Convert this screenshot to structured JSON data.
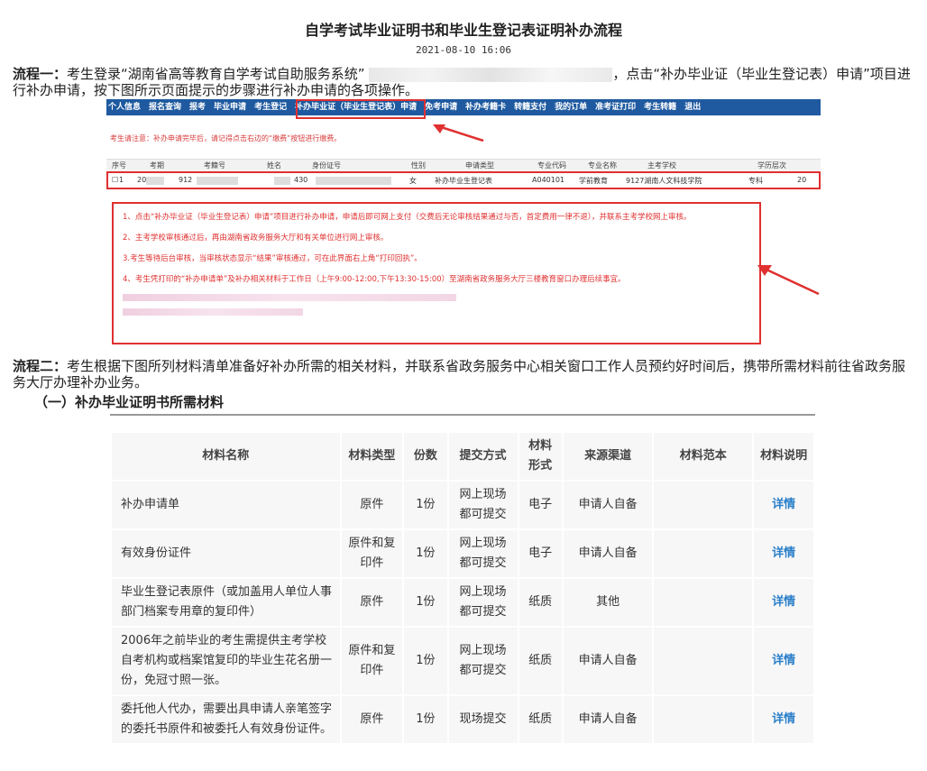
{
  "doc": {
    "title": "自学考试毕业证明书和毕业生登记表证明补办流程",
    "date": "2021-08-10 16:06"
  },
  "process1": {
    "label": "流程一：",
    "text_a": "考生登录“湖南省高等教育自学考试自助服务系统”",
    "text_b": "，点击“补办毕业证（毕业生登记表）申请”项目进行补办申请，按下图所示页面提示的步骤进行补办申请的各项操作。"
  },
  "screenshot": {
    "nav": [
      "个人信息",
      "报名查询",
      "报考",
      "毕业申请",
      "考生登记",
      "补办毕业证（毕业生登记表）申请",
      "免考申请",
      "补办考籍卡",
      "转籍支付",
      "我的订单",
      "准考证打印",
      "考生转籍",
      "退出"
    ],
    "notice": "考生请注意：补办申请完毕后，请记得点击右边的“缴费”按钮进行缴费。",
    "headers": [
      "序号",
      "考期",
      "考籍号",
      "姓名",
      "身份证号",
      "性别",
      "申请类型",
      "专业代码",
      "专业名称",
      "主考学校",
      "学历层次"
    ],
    "row": [
      "1",
      "20",
      "912",
      "",
      "430",
      "女",
      "补办毕业生登记表",
      "A040101",
      "学前教育",
      "9127湖南人文科技学院",
      "专科",
      "20"
    ],
    "instructions": [
      "1、点击“补办毕业证（毕业生登记表）申请”项目进行补办申请，申请后即可网上支付（交费后无论审核结果通过与否，首定费用一律不退），并联系主考学校网上审核。",
      "2、主考学校审核通过后，再由湖南省政务服务大厅和有关单位进行网上审核。",
      "3.考生等待后台审核，当审核状态显示“结果”审核通过，可在此界面右上角“打印回执”。",
      "4、考生凭打印的“补办申请单”及补办相关材料于工作日（上午9:00-12:00,下午13:30-15:00）至湖南省政务服务大厅三楼教育窗口办理后续事宜。"
    ]
  },
  "process2": {
    "label": "流程二：",
    "text": "考生根据下图所列材料清单准备好补办所需的相关材料，并联系省政务服务中心相关窗口工作人员预约好时间后，携带所需材料前往省政务服务大厅办理补办业务。"
  },
  "section1": {
    "title": "（一）补办毕业证明书所需材料"
  },
  "materials": {
    "headers": [
      "材料名称",
      "材料类型",
      "份数",
      "提交方式",
      "材料形式",
      "来源渠道",
      "材料范本",
      "材料说明"
    ],
    "rows": [
      {
        "name": "补办申请单",
        "type": "原件",
        "count": "1份",
        "submit": "网上现场都可提交",
        "form": "电子",
        "source": "申请人自备",
        "sample": "",
        "detail": "详情"
      },
      {
        "name": "有效身份证件",
        "type": "原件和复印件",
        "count": "1份",
        "submit": "网上现场都可提交",
        "form": "电子",
        "source": "申请人自备",
        "sample": "",
        "detail": "详情"
      },
      {
        "name": "毕业生登记表原件（或加盖用人单位人事部门档案专用章的复印件）",
        "type": "原件",
        "count": "1份",
        "submit": "网上现场都可提交",
        "form": "纸质",
        "source": "其他",
        "sample": "",
        "detail": "详情"
      },
      {
        "name": "2006年之前毕业的考生需提供主考学校自考机构或档案馆复印的毕业生花名册一份，免冠寸照一张。",
        "type": "原件和复印件",
        "count": "1份",
        "submit": "网上现场都可提交",
        "form": "纸质",
        "source": "申请人自备",
        "sample": "",
        "detail": "详情"
      },
      {
        "name": "委托他人代办，需要出具申请人亲笔签字的委托书原件和被委托人有效身份证件。",
        "type": "原件",
        "count": "1份",
        "submit": "现场提交",
        "form": "纸质",
        "source": "申请人自备",
        "sample": "",
        "detail": "详情"
      }
    ]
  },
  "colors": {
    "accent_red": "#e03030",
    "nav_blue": "#1f5aa0",
    "link_blue": "#2a7fc9"
  }
}
